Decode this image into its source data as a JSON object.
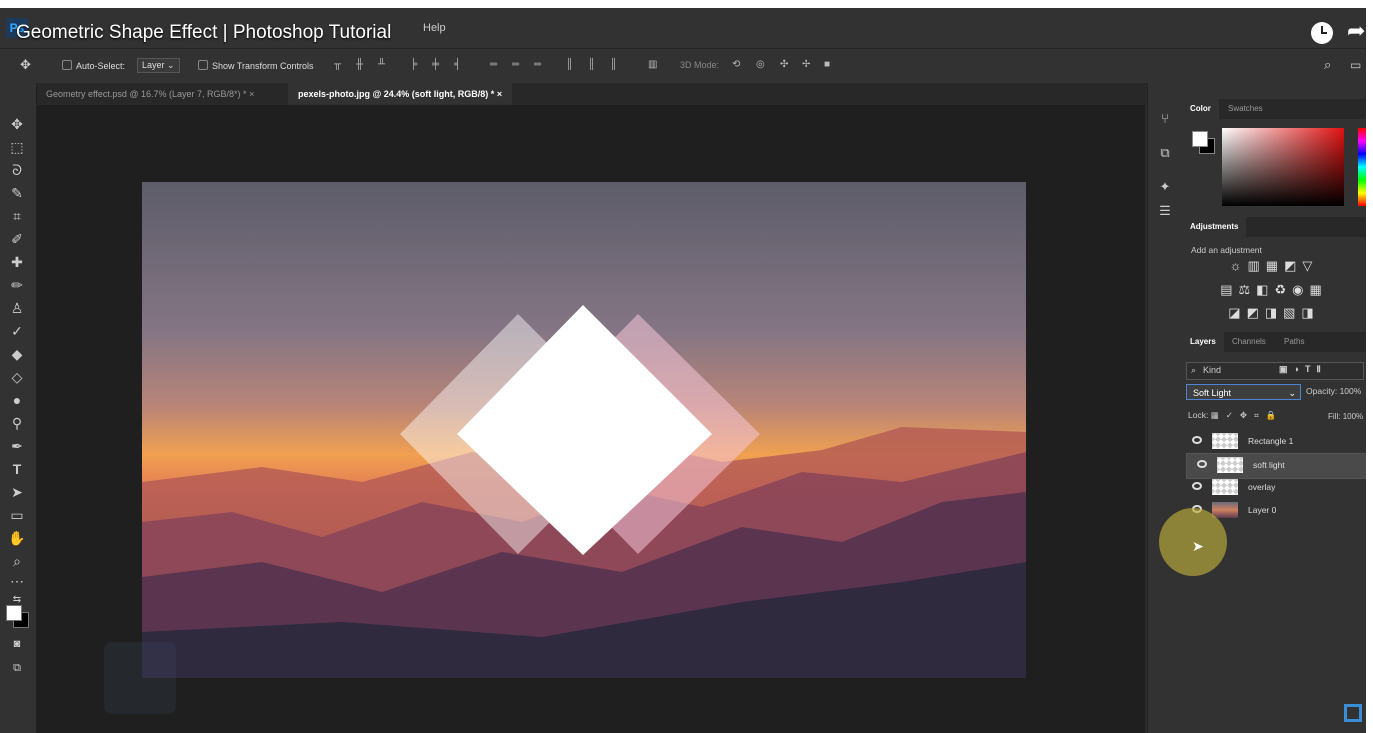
{
  "video": {
    "title": "Geometric Shape Effect | Photoshop Tutorial"
  },
  "menubar": {
    "logo": "Ps",
    "help_label": "Help"
  },
  "options": {
    "auto_select_label": "Auto-Select:",
    "auto_select_value": "Layer",
    "show_transform_label": "Show Transform Controls",
    "mode_3d_label": "3D Mode:"
  },
  "tabs": [
    {
      "label": "Geometry effect.psd @ 16.7% (Layer 7, RGB/8*) *"
    },
    {
      "label": "pexels-photo.jpg @ 24.4% (soft light, RGB/8) *"
    }
  ],
  "color_panel": {
    "tabs": [
      "Color",
      "Swatches"
    ]
  },
  "adjustments": {
    "tab": "Adjustments",
    "title": "Add an adjustment"
  },
  "layers_panel": {
    "tabs": [
      "Layers",
      "Channels",
      "Paths"
    ],
    "filter_label": "Kind",
    "blend_mode": "Soft Light",
    "opacity_label": "Opacity:",
    "opacity_value": "100%",
    "lock_label": "Lock:",
    "fill_label": "Fill:",
    "fill_value": "100%",
    "layers": [
      {
        "name": "Rectangle 1",
        "selected": false
      },
      {
        "name": "soft light",
        "selected": true
      },
      {
        "name": "overlay",
        "selected": false
      },
      {
        "name": "Layer 0",
        "selected": false
      }
    ]
  },
  "colors": {
    "accent": "#4d86d0",
    "panel_bg": "#323232",
    "canvas_bg": "#1f1f1f"
  }
}
